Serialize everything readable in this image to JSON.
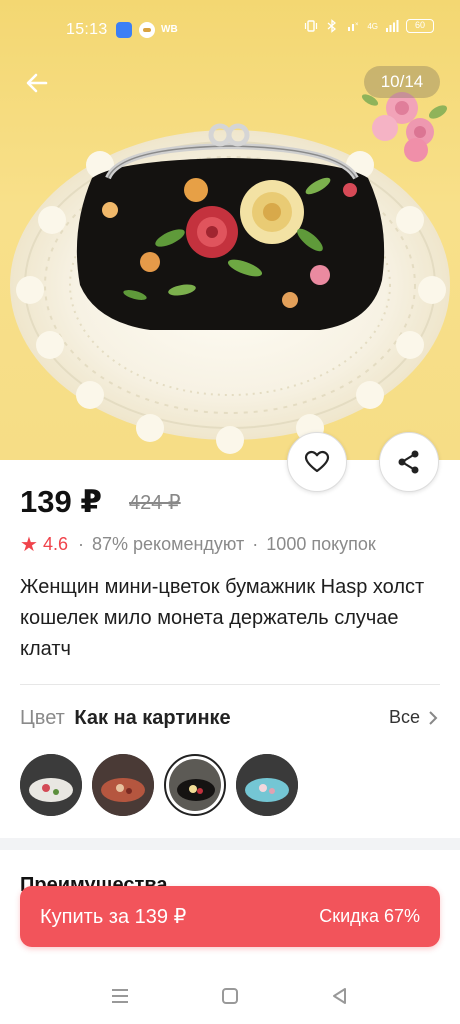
{
  "status_bar": {
    "time": "15:13",
    "app_label": "WB",
    "network": "4G",
    "battery": "60"
  },
  "gallery": {
    "counter": "10/14",
    "icons": [
      "arrow-left-icon",
      "heart-icon",
      "share-icon"
    ]
  },
  "product": {
    "price": "139 ₽",
    "old_price": "424 ₽",
    "rating": "4.6",
    "recommend": "87% рекомендуют",
    "purchases": "1000 покупок",
    "title": "Женщин мини-цветок бумажник Hasp холст кошелек мило монета держатель случае клатч"
  },
  "color": {
    "label": "Цвет",
    "value": "Как на картинке",
    "all_link": "Все"
  },
  "section": {
    "advantages": "Преимущества"
  },
  "buy_button": {
    "label": "Купить за 139 ₽",
    "discount": "Скидка 67%"
  },
  "colors": {
    "accent": "#f2545b",
    "star": "#f0434b"
  }
}
